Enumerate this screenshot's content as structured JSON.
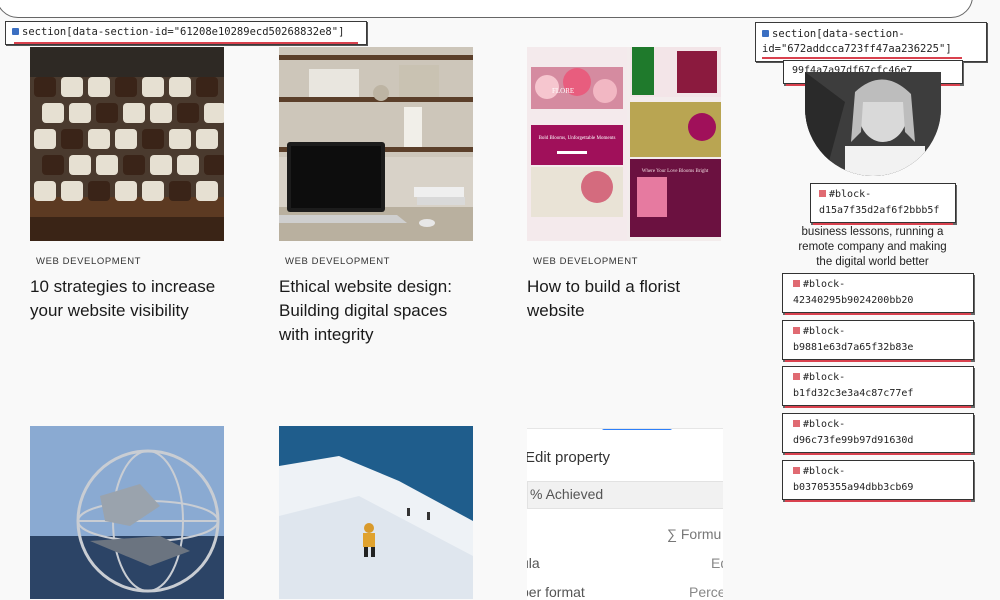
{
  "sections": {
    "left_selector": "section[data-section-id=\"61208e10289ecd50268832e8\"]",
    "right_selector_line1": "section[data-section-",
    "right_selector_line2": "id=\"672addcca723ff47aa236225\"]"
  },
  "sidebar": {
    "partial_block_id": "99f4a7a97df67cfc46e7",
    "avatar_block_line1": "#block-",
    "avatar_block_line2": "d15a7f35d2af6f2bbb5f",
    "bio_text": "business lessons, running a remote company and making the digital world better",
    "blocks": [
      {
        "line1": "#block-",
        "line2": "42340295b9024200bb20"
      },
      {
        "line1": "#block-",
        "line2": "b9881e63d7a65f32b83e"
      },
      {
        "line1": "#block-",
        "line2": "b1fd32c3e3a4c87c77ef"
      },
      {
        "line1": "#block-",
        "line2": "d96c73fe99b97d91630d"
      },
      {
        "line1": "#block-",
        "line2": "b03705355a94dbb3cb69"
      }
    ]
  },
  "posts": [
    {
      "category": "WEB DEVELOPMENT",
      "title": "10 strategies to increase your website visibility",
      "image": "typewriter-keys"
    },
    {
      "category": "WEB DEVELOPMENT",
      "title": "Ethical website design: Building digital spaces with integrity",
      "image": "laptop-on-desk"
    },
    {
      "category": "WEB DEVELOPMENT",
      "title": "How to build a florist website",
      "image": "florist-website-mockup"
    },
    {
      "category": "",
      "title": "",
      "image": "unisphere-globe"
    },
    {
      "category": "",
      "title": "",
      "image": "snowboarder"
    }
  ],
  "florist_mock": {
    "brand": "FLORE",
    "tagline": "Bold Blooms, Unforgettable Moments",
    "banner": "Where Your Love Blooms Bright"
  },
  "edit_panel": {
    "header": "Edit property",
    "field_value": "% Achieved",
    "formula_label": "∑ Formu",
    "row1_left": "ula",
    "row1_right": "Ed",
    "row2_left": "ber format",
    "row2_right": "Perce"
  },
  "colors": {
    "highlight_red": "#d9414e",
    "accent_blue": "#2d7ff9",
    "florist_magenta": "#a0105a"
  }
}
